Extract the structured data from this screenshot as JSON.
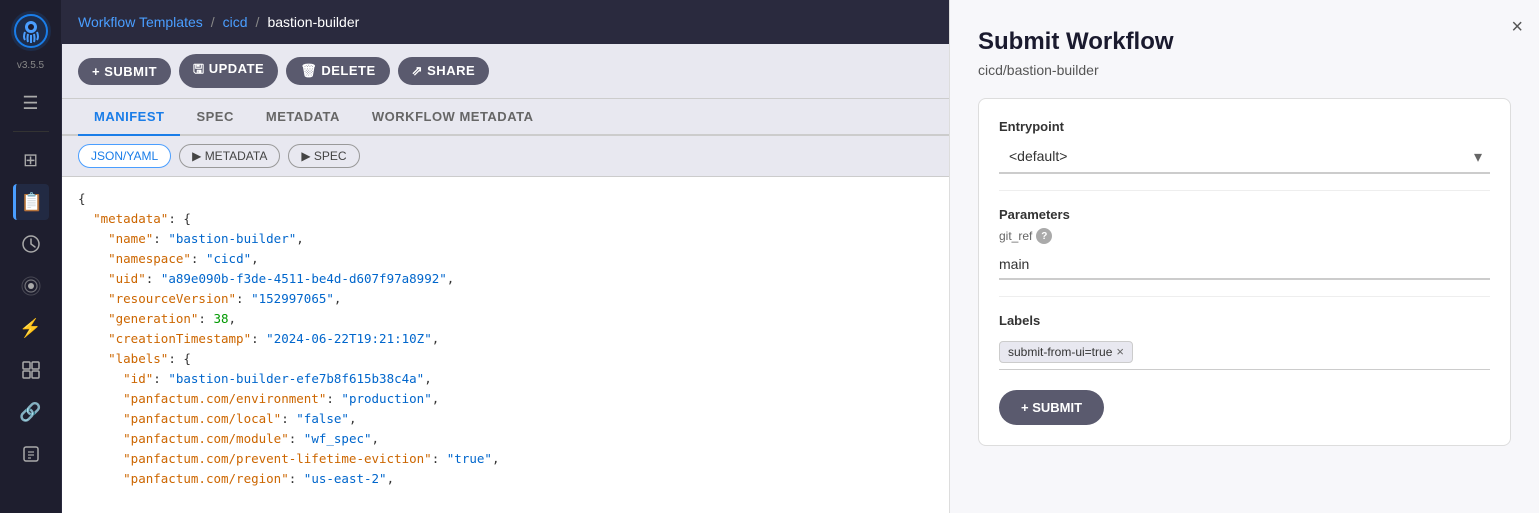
{
  "app": {
    "version": "v3.5.5",
    "logo_alt": "Argo Workflows"
  },
  "sidebar": {
    "icons": [
      {
        "name": "menu-icon",
        "symbol": "☰",
        "active": false
      },
      {
        "name": "dashboard-icon",
        "symbol": "▣",
        "active": false
      },
      {
        "name": "workflows-icon",
        "symbol": "📋",
        "active": true
      },
      {
        "name": "history-icon",
        "symbol": "🕐",
        "active": false
      },
      {
        "name": "sensors-icon",
        "symbol": "📡",
        "active": false
      },
      {
        "name": "lightning-icon",
        "symbol": "⚡",
        "active": false
      },
      {
        "name": "feed-icon",
        "symbol": "◉",
        "active": false
      },
      {
        "name": "link-icon",
        "symbol": "🔗",
        "active": false
      },
      {
        "name": "reports-icon",
        "symbol": "📊",
        "active": false
      }
    ]
  },
  "breadcrumb": {
    "workflow_templates": "Workflow Templates",
    "separator1": "/",
    "cicd": "cicd",
    "separator2": "/",
    "current": "bastion-builder"
  },
  "toolbar": {
    "submit_label": "+ SUBMIT",
    "update_label": "🖫 UPDATE",
    "delete_label": "🗑 DELETE",
    "share_label": "⇗ SHARE"
  },
  "tabs": [
    {
      "id": "manifest",
      "label": "MANIFEST",
      "active": true
    },
    {
      "id": "spec",
      "label": "SPEC",
      "active": false
    },
    {
      "id": "metadata",
      "label": "METADATA",
      "active": false
    },
    {
      "id": "workflow-metadata",
      "label": "WORKFLOW METADATA",
      "active": false
    }
  ],
  "sub_toolbar": [
    {
      "id": "json-yaml",
      "label": "JSON/YAML",
      "active": true
    },
    {
      "id": "metadata",
      "label": "▶ METADATA",
      "active": false
    },
    {
      "id": "spec",
      "label": "▶ SPEC",
      "active": false
    }
  ],
  "code": {
    "lines": [
      "{",
      "  \"metadata\": {",
      "    \"name\": \"bastion-builder\",",
      "    \"namespace\": \"cicd\",",
      "    \"uid\": \"a89e090b-f3de-4511-be4d-d607f97a8992\",",
      "    \"resourceVersion\": \"152997065\",",
      "    \"generation\": 38,",
      "    \"creationTimestamp\": \"2024-06-22T19:21:10Z\",",
      "    \"labels\": {",
      "      \"id\": \"bastion-builder-efe7b8f615b38c4a\",",
      "      \"panfactum.com/environment\": \"production\",",
      "      \"panfactum.com/local\": \"false\",",
      "      \"panfactum.com/module\": \"wf_spec\",",
      "      \"panfactum.com/prevent-lifetime-eviction\": \"true\",",
      "      \"panfactum.com/region\": \"us-east-2\","
    ]
  },
  "right_panel": {
    "title": "Submit Workflow",
    "subtitle": "cicd/bastion-builder",
    "close_label": "×",
    "form": {
      "entrypoint_label": "Entrypoint",
      "entrypoint_value": "<default>",
      "entrypoint_options": [
        "<default>"
      ],
      "parameters_label": "Parameters",
      "git_ref_label": "git_ref",
      "git_ref_value": "main",
      "labels_label": "Labels",
      "label_tag": "submit-from-ui=true",
      "submit_label": "+ SUBMIT"
    }
  }
}
